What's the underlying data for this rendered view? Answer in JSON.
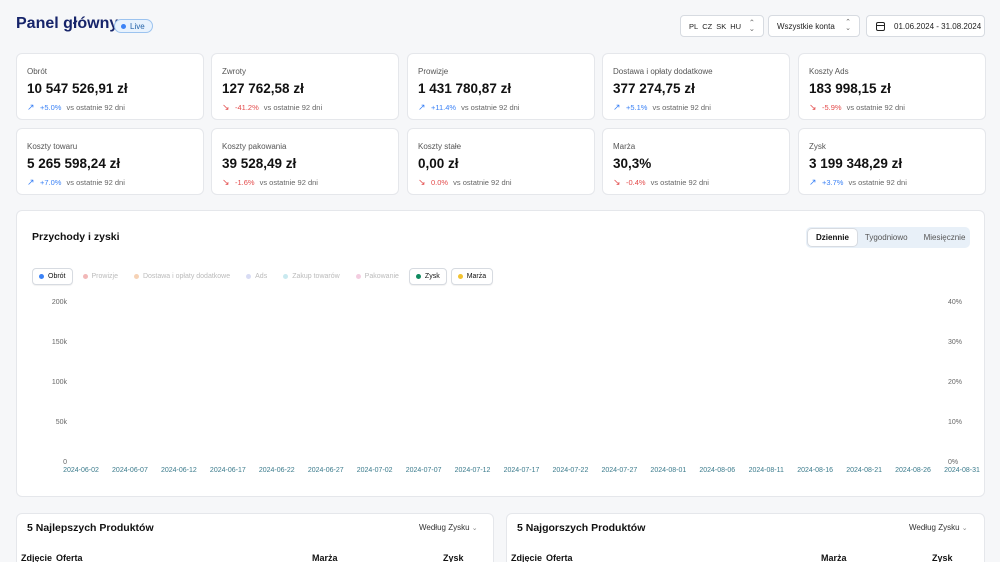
{
  "header": {
    "title": "Panel główny",
    "live_label": "Live",
    "languages": [
      "PL",
      "CZ",
      "SK",
      "HU"
    ],
    "account_select": "Wszystkie konta",
    "date_range": "01.06.2024 - 31.08.2024"
  },
  "kpis": [
    {
      "label": "Obrót",
      "value": "10 547 526,91 zł",
      "change": "+5.0%",
      "trend": "up",
      "vs": "vs ostatnie 92 dni"
    },
    {
      "label": "Zwroty",
      "value": "127 762,58 zł",
      "change": "-41.2%",
      "trend": "down",
      "vs": "vs ostatnie 92 dni"
    },
    {
      "label": "Prowizje",
      "value": "1 431 780,87 zł",
      "change": "+11.4%",
      "trend": "up",
      "vs": "vs ostatnie 92 dni"
    },
    {
      "label": "Dostawa i opłaty dodatkowe",
      "value": "377 274,75 zł",
      "change": "+5.1%",
      "trend": "up",
      "vs": "vs ostatnie 92 dni"
    },
    {
      "label": "Koszty Ads",
      "value": "183 998,15 zł",
      "change": "-5.9%",
      "trend": "down",
      "vs": "vs ostatnie 92 dni"
    },
    {
      "label": "Koszty towaru",
      "value": "5 265 598,24 zł",
      "change": "+7.0%",
      "trend": "up",
      "vs": "vs ostatnie 92 dni"
    },
    {
      "label": "Koszty pakowania",
      "value": "39 528,49 zł",
      "change": "-1.6%",
      "trend": "down",
      "vs": "vs ostatnie 92 dni"
    },
    {
      "label": "Koszty stałe",
      "value": "0,00 zł",
      "change": "0.0%",
      "trend": "down",
      "vs": "vs ostatnie 92 dni"
    },
    {
      "label": "Marża",
      "value": "30,3%",
      "change": "-0.4%",
      "trend": "down",
      "vs": "vs ostatnie 92 dni"
    },
    {
      "label": "Zysk",
      "value": "3 199 348,29 zł",
      "change": "+3.7%",
      "trend": "up",
      "vs": "vs ostatnie 92 dni"
    }
  ],
  "revenue_panel": {
    "title": "Przychody i zyski",
    "periods": [
      {
        "label": "Dziennie",
        "active": true
      },
      {
        "label": "Tygodniowo",
        "active": false
      },
      {
        "label": "Miesięcznie",
        "active": false
      }
    ],
    "legend": [
      {
        "label": "Obrót",
        "color": "#3b82f6",
        "active": true
      },
      {
        "label": "Prowizje",
        "color": "#f2b8b8",
        "active": false
      },
      {
        "label": "Dostawa i opłaty dodatkowe",
        "color": "#f6d2b5",
        "active": false
      },
      {
        "label": "Ads",
        "color": "#d8dcf4",
        "active": false
      },
      {
        "label": "Zakup towarów",
        "color": "#c9e9ef",
        "active": false
      },
      {
        "label": "Pakowanie",
        "color": "#f3cde0",
        "active": false
      },
      {
        "label": "Zysk",
        "color": "#0f8a5f",
        "active": true
      },
      {
        "label": "Marża",
        "color": "#f2c230",
        "active": true
      }
    ]
  },
  "chart_data": {
    "type": "line",
    "title": "",
    "x": [
      "2024-06-02",
      "2024-06-07",
      "2024-06-12",
      "2024-06-17",
      "2024-06-22",
      "2024-06-27",
      "2024-07-02",
      "2024-07-07",
      "2024-07-12",
      "2024-07-17",
      "2024-07-22",
      "2024-07-27",
      "2024-08-01",
      "2024-08-06",
      "2024-08-11",
      "2024-08-16",
      "2024-08-21",
      "2024-08-26",
      "2024-08-31"
    ],
    "y_left_ticks": [
      "200k",
      "150k",
      "100k",
      "50k",
      "0"
    ],
    "y_right_ticks": [
      "40%",
      "30%",
      "20%",
      "10%",
      "0%"
    ],
    "ylim_left": [
      0,
      200000
    ],
    "ylim_right": [
      0,
      40
    ],
    "series": [],
    "grid": false
  },
  "best_products": {
    "title": "5 Najlepszych Produktów",
    "sort_label": "Według Zysku",
    "columns": [
      "Zdjęcie",
      "Oferta",
      "Marża",
      "Zysk"
    ]
  },
  "worst_products": {
    "title": "5 Najgorszych Produktów",
    "sort_label": "Według Zysku",
    "columns": [
      "Zdjęcie",
      "Oferta",
      "Marża",
      "Zysk"
    ]
  }
}
